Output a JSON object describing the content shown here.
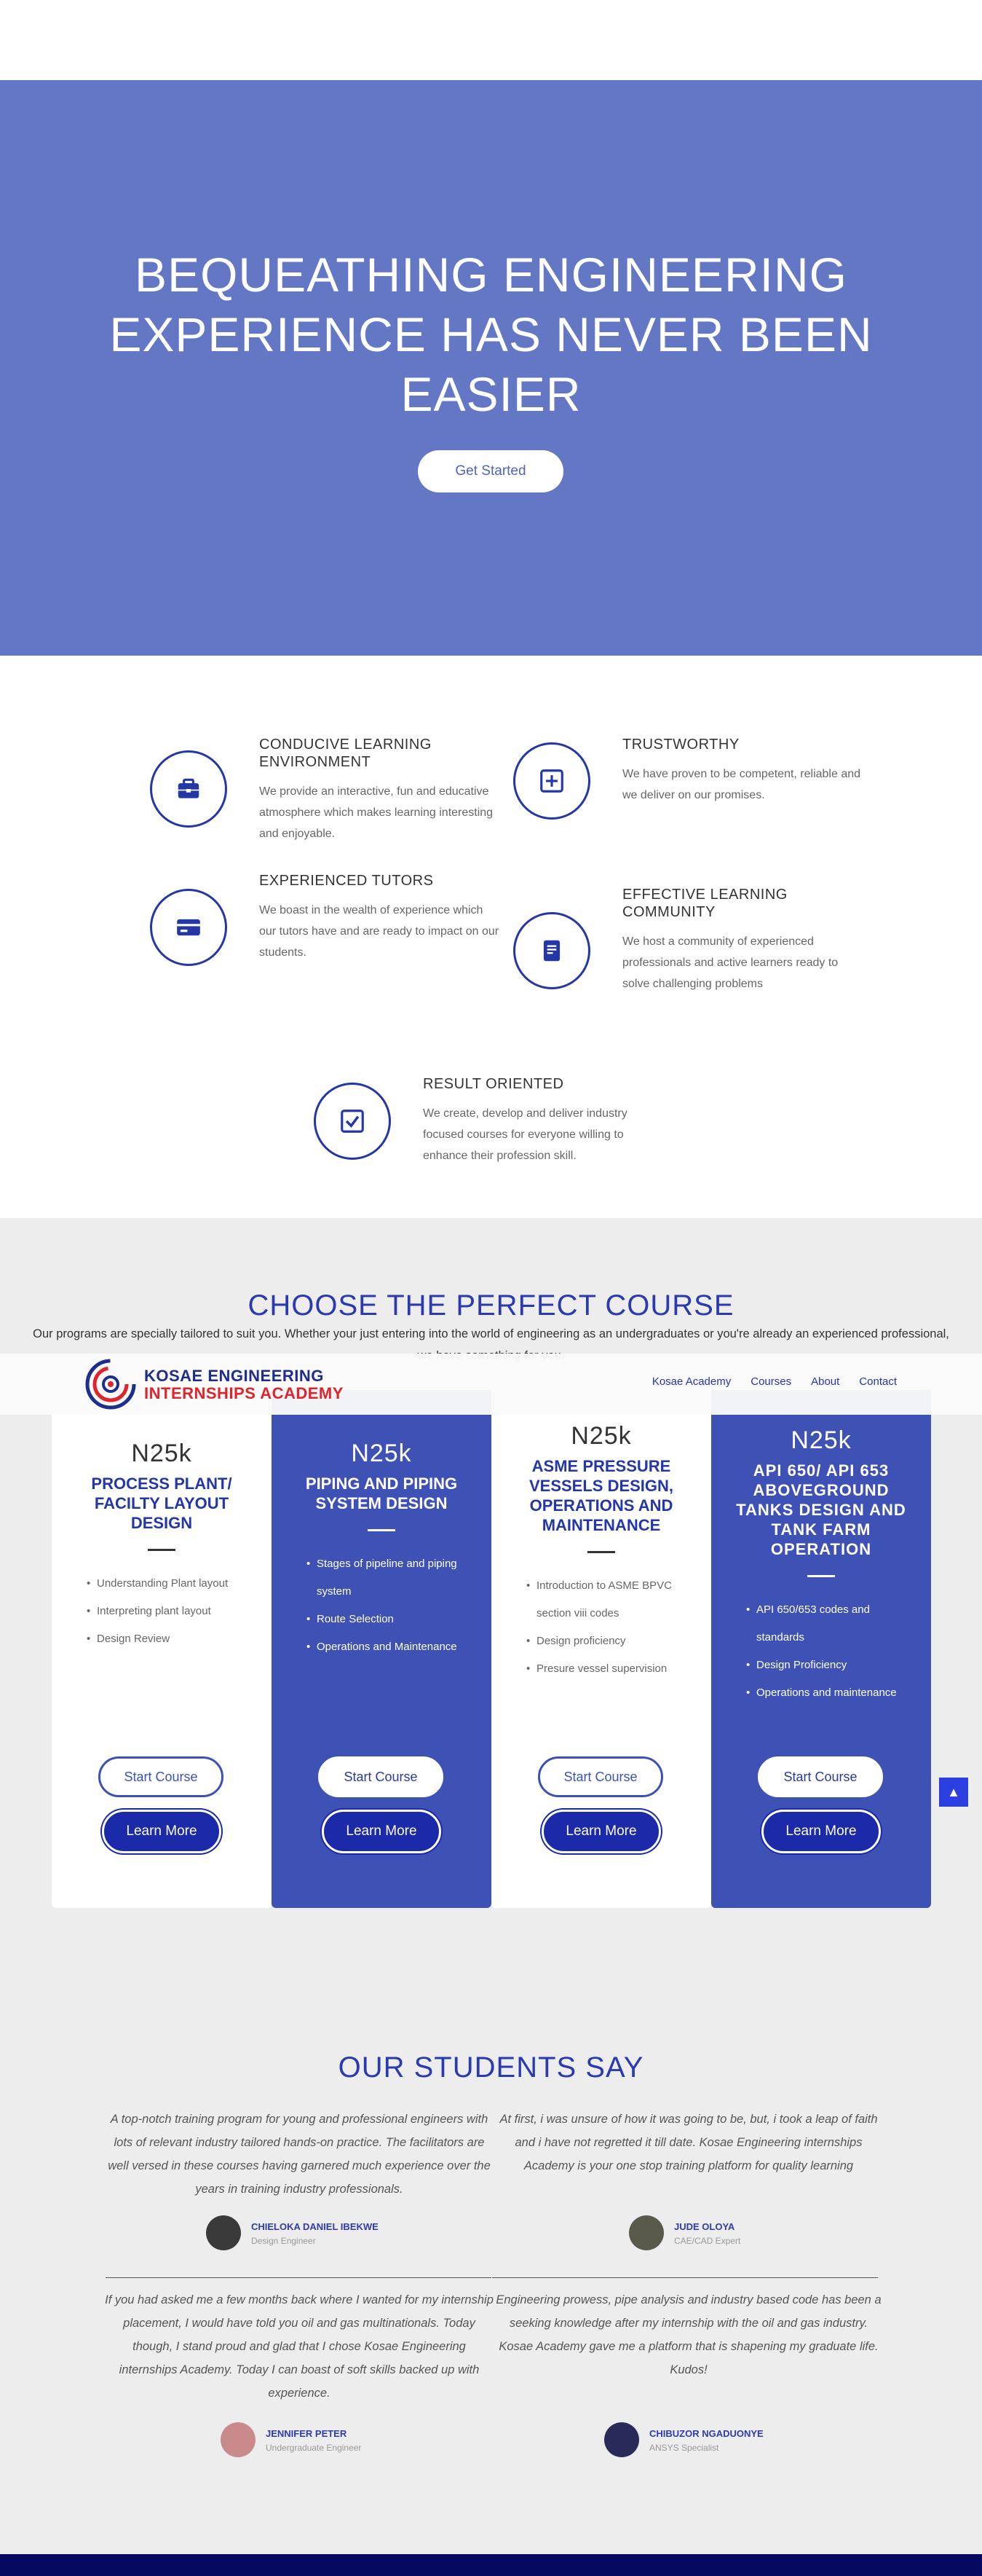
{
  "hero": {
    "title": "BEQUEATHING ENGINEERING EXPERIENCE HAS NEVER BEEN EASIER",
    "button": "Get Started"
  },
  "features": [
    {
      "title": "CONDUCIVE LEARNING ENVIRONMENT",
      "text": "We provide an interactive, fun and educative atmosphere which makes learning interesting and enjoyable.",
      "icon": "briefcase-icon"
    },
    {
      "title": "TRUSTWORTHY",
      "text": "We have proven to be competent, reliable and we deliver on our promises.",
      "icon": "plus-square-icon"
    },
    {
      "title": "EXPERIENCED TUTORS",
      "text": "We boast in the wealth of experience which our tutors have and are ready to impact on our students.",
      "icon": "card-icon"
    },
    {
      "title": "EFFECTIVE LEARNING COMMUNITY",
      "text": "We host a community of experienced professionals and active learners ready to solve challenging problems",
      "icon": "book-icon"
    },
    {
      "title": "RESULT ORIENTED",
      "text": "We create, develop and deliver industry focused courses for everyone willing to enhance their profession skill.",
      "icon": "checkbox-icon"
    }
  ],
  "courses": {
    "title": "CHOOSE THE PERFECT COURSE",
    "subtitle": "Our programs are specially tailored to suit you. Whether your just entering into the world of engineering  as an undergraduates or you're already an experienced professional, we have something for you.",
    "start_label": "Start Course",
    "learn_label": "Learn More",
    "items": [
      {
        "price": "N25k",
        "title": "PROCESS PLANT/ FACILTY LAYOUT DESIGN",
        "bullets": [
          "Understanding Plant layout",
          "Interpreting plant layout",
          "Design Review"
        ]
      },
      {
        "price": "N25k",
        "title": "PIPING AND PIPING SYSTEM DESIGN",
        "bullets": [
          "Stages of pipeline and piping system",
          "Route Selection",
          "Operations and Maintenance"
        ]
      },
      {
        "price": "N25k",
        "title": "ASME PRESSURE VESSELS DESIGN, OPERATIONS AND MAINTENANCE",
        "bullets": [
          "Introduction to ASME BPVC section viii codes",
          "Design proficiency",
          "Presure vessel supervision"
        ]
      },
      {
        "price": "N25k",
        "title": "API 650/ API 653 ABOVEGROUND TANKS DESIGN AND TANK FARM OPERATION",
        "bullets": [
          "API 650/653 codes and standards",
          "Design Proficiency",
          "Operations and maintenance"
        ]
      }
    ]
  },
  "nav": {
    "logo_line1": "KOSAE ENGINEERING",
    "logo_line2": "INTERNSHIPS ACADEMY",
    "links": [
      "Kosae Academy",
      "Courses",
      "About",
      "Contact"
    ]
  },
  "testimonials": {
    "title": "OUR STUDENTS SAY",
    "items": [
      {
        "quote": "A top-notch training program for young and professional engineers with lots of relevant industry tailored hands-on practice. The facilitators are well versed in these courses having garnered much experience over the years in training industry professionals.",
        "name": "CHIELOKA DANIEL IBEKWE",
        "role": "Design Engineer"
      },
      {
        "quote": "At first, i was unsure of how it was going to be, but, i took a leap of faith and i have not regretted it till date. Kosae Engineering internships Academy is your one stop training platform for quality learning",
        "name": "JUDE OLOYA",
        "role": "CAE/CAD Expert"
      },
      {
        "quote": "If you had asked me a few months back where I wanted for my internship placement, I would have told you oil and gas multinationals. Today though, I stand proud and glad that I chose Kosae Engineering internships Academy. Today I can boast of soft skills backed up with experience.",
        "name": "JENNIFER PETER",
        "role": "Undergraduate Engineer"
      },
      {
        "quote": "Engineering prowess, pipe analysis and industry based code has been a seeking knowledge after my internship with the oil and gas industry. Kosae Academy gave me a platform that is shapening my graduate life.\nKudos!",
        "name": "CHIBUZOR NGADUONYE",
        "role": "ANSYS Specialist"
      }
    ]
  },
  "colors": {
    "hero": "#6477c5",
    "accent": "#2437a6",
    "card_dark": "#3e52b5",
    "footer": "#05095f"
  }
}
